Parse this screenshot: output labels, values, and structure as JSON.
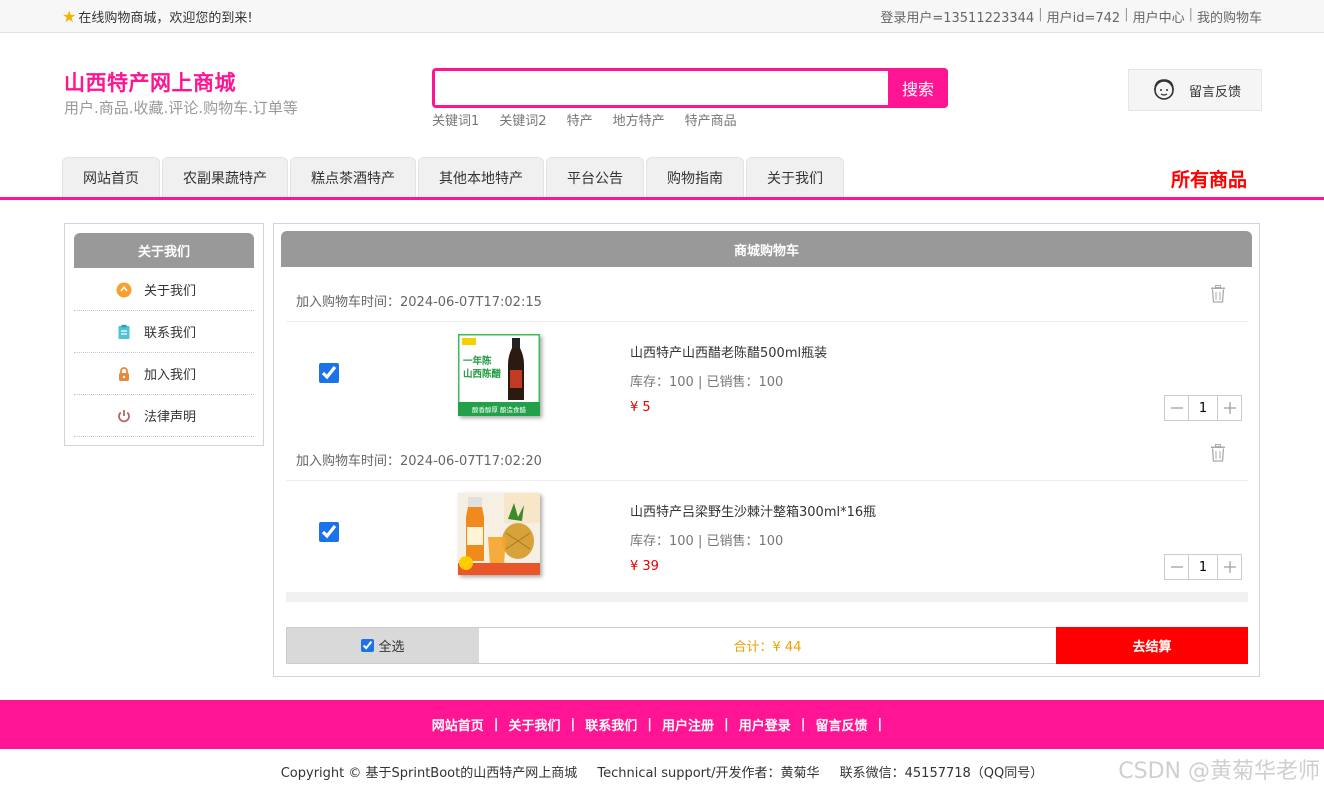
{
  "topbar": {
    "welcome": "在线购物商城，欢迎您的到来!",
    "user_info": "登录用户=13511223344",
    "user_id": "用户id=742",
    "user_center": "用户中心",
    "my_cart": "我的购物车"
  },
  "header": {
    "title": "山西特产网上商城",
    "subtitle": "用户.商品.收藏.评论.购物车.订单等",
    "search_value": "",
    "search_button": "搜索",
    "keywords": [
      "关键词1",
      "关键词2",
      "特产",
      "地方特产",
      "特产商品"
    ],
    "feedback": "留言反馈"
  },
  "nav": {
    "tabs": [
      "网站首页",
      "农副果蔬特产",
      "糕点茶酒特产",
      "其他本地特产",
      "平台公告",
      "购物指南",
      "关于我们"
    ],
    "all_goods": "所有商品"
  },
  "sidebar": {
    "title": "关于我们",
    "items": [
      {
        "label": "关于我们",
        "icon": "orange-circle-icon"
      },
      {
        "label": "联系我们",
        "icon": "clipboard-icon"
      },
      {
        "label": "加入我们",
        "icon": "lock-icon"
      },
      {
        "label": "法律声明",
        "icon": "power-icon"
      }
    ]
  },
  "cart": {
    "title": "商城购物车",
    "items": [
      {
        "time": "加入购物车时间：2024-06-07T17:02:15",
        "name": "山西特产山西醋老陈醋500ml瓶装",
        "stock": "库存：100 | 已销售：100",
        "price": "¥ 5",
        "qty": "1",
        "img_text_top": "一年陈",
        "img_text_mid": "山西陈醋",
        "img_text_bottom": "酸香醇厚 酿造食醋"
      },
      {
        "time": "加入购物车时间：2024-06-07T17:02:20",
        "name": "山西特产吕梁野生沙棘汁整箱300ml*16瓶",
        "stock": "库存：100 | 已销售：100",
        "price": "¥ 39",
        "qty": "1"
      }
    ],
    "select_all": "全选",
    "total": "合计：¥ 44",
    "checkout": "去结算"
  },
  "footer": {
    "links": [
      "网站首页",
      "关于我们",
      "联系我们",
      "用户注册",
      "用户登录",
      "留言反馈"
    ],
    "copyright": "Copyright © 基于SprintBoot的山西特产网上商城",
    "support": "Technical support/开发作者：黄菊华",
    "contact": "联系微信：45157718（QQ同号）",
    "watermark": "CSDN @黄菊华老师"
  },
  "colors": {
    "brand": "#ff1493",
    "accent_red": "#ff0000",
    "price_red": "#e60000",
    "total_orange": "#f0a000",
    "header_grey": "#999999"
  }
}
